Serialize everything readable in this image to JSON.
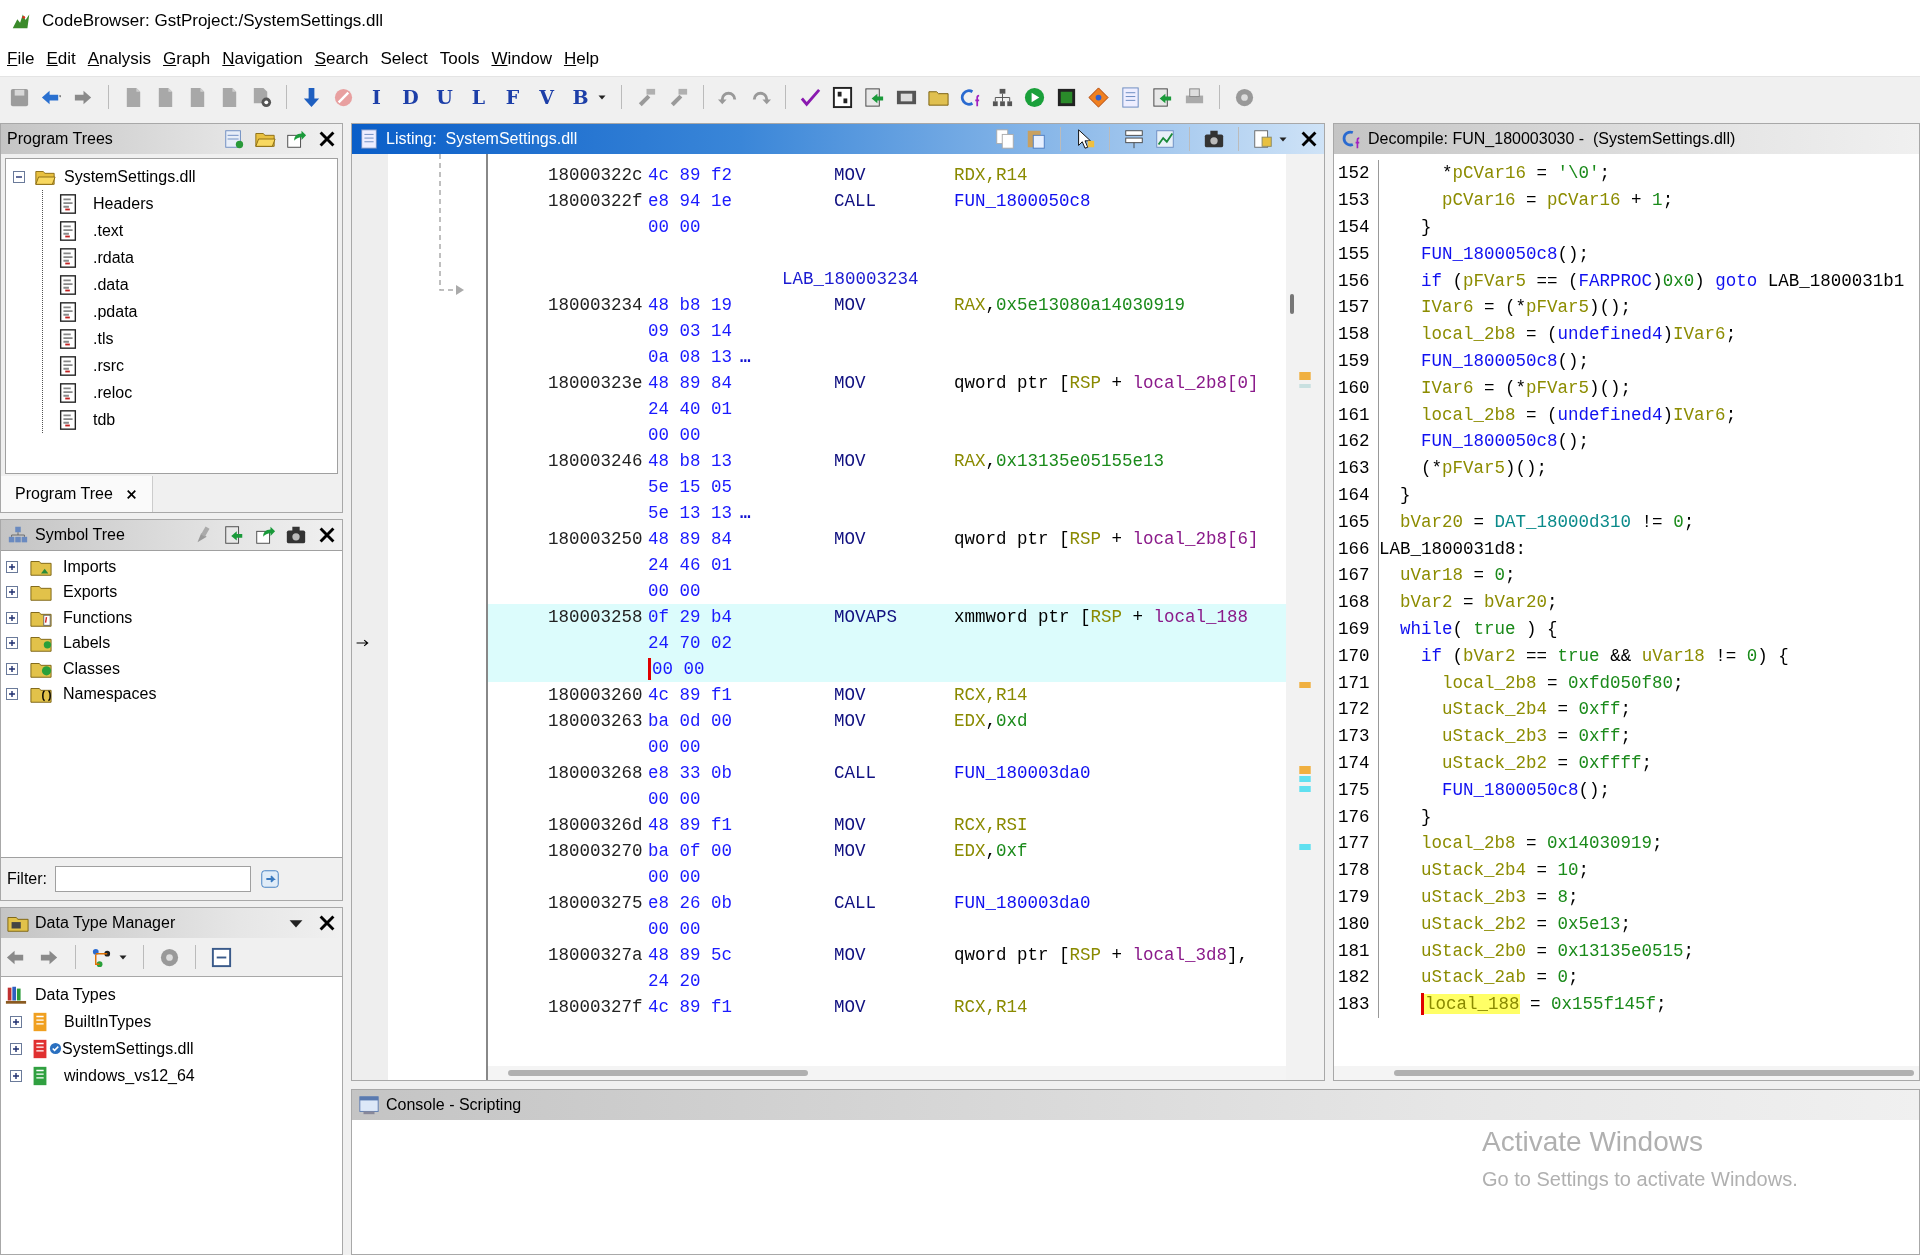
{
  "window": {
    "title": "CodeBrowser: GstProject:/SystemSettings.dll"
  },
  "menu": [
    {
      "label": "File",
      "underline_first": true
    },
    {
      "label": "Edit",
      "underline_first": true
    },
    {
      "label": "Analysis",
      "underline_first": true
    },
    {
      "label": "Graph",
      "underline_first": true
    },
    {
      "label": "Navigation",
      "underline_first": true
    },
    {
      "label": "Search",
      "underline_first": true
    },
    {
      "label": "Select",
      "underline_first": false
    },
    {
      "label": "Tools",
      "underline_first": false
    },
    {
      "label": "Window",
      "underline_first": true
    },
    {
      "label": "Help",
      "underline_first": true
    }
  ],
  "toolbar": {
    "letter_buttons": [
      "I",
      "D",
      "U",
      "L",
      "F",
      "V",
      "B"
    ]
  },
  "program_trees": {
    "title": "Program Trees",
    "root": {
      "label": "SystemSettings.dll",
      "expanded": true,
      "children": [
        {
          "label": "Headers"
        },
        {
          "label": ".text"
        },
        {
          "label": ".rdata"
        },
        {
          "label": ".data"
        },
        {
          "label": ".pdata"
        },
        {
          "label": ".tls"
        },
        {
          "label": ".rsrc"
        },
        {
          "label": ".reloc"
        },
        {
          "label": "tdb"
        }
      ]
    },
    "tab": {
      "label": "Program Tree"
    }
  },
  "symbol_tree": {
    "title": "Symbol Tree",
    "items": [
      {
        "label": "Imports",
        "expanded": false
      },
      {
        "label": "Exports",
        "expanded": false
      },
      {
        "label": "Functions",
        "expanded": false
      },
      {
        "label": "Labels",
        "expanded": false
      },
      {
        "label": "Classes",
        "expanded": false
      },
      {
        "label": "Namespaces",
        "expanded": false
      }
    ],
    "filter": {
      "label": "Filter:"
    }
  },
  "data_type_manager": {
    "title": "Data Type Manager",
    "root": {
      "label": "Data Types",
      "children": [
        {
          "label": "BuiltInTypes",
          "expanded": false,
          "color": "#f0a020",
          "badge": false
        },
        {
          "label": "SystemSettings.dll",
          "expanded": false,
          "color": "#e03030",
          "badge": true
        },
        {
          "label": "windows_vs12_64",
          "expanded": false,
          "color": "#30a040",
          "badge": false
        }
      ]
    }
  },
  "listing": {
    "title": "Listing:  SystemSettings.dll",
    "rows": [
      {
        "kind": "instr",
        "address": "18000322c",
        "bytes": [
          "4c 89 f2"
        ],
        "mnemonic": "MOV",
        "operands": [
          {
            "kind": "reg",
            "text": "RDX,R14"
          }
        ],
        "selected": false
      },
      {
        "kind": "instr",
        "address": "18000322f",
        "bytes": [
          "e8 94 1e",
          "00 00"
        ],
        "mnemonic": "CALL",
        "operands": [
          {
            "kind": "func",
            "text": "FUN_1800050c8"
          }
        ],
        "selected": false
      },
      {
        "kind": "label",
        "text": "LAB_180003234"
      },
      {
        "kind": "instr",
        "address": "180003234",
        "bytes": [
          "48 b8 19",
          "09 03 14",
          "0a 08 13"
        ],
        "more": "…",
        "mnemonic": "MOV",
        "operands": [
          {
            "kind": "reg",
            "text": "RAX"
          },
          {
            "kind": "plain",
            "text": ","
          },
          {
            "kind": "num",
            "text": "0x5e13080a14030919"
          }
        ],
        "selected": false
      },
      {
        "kind": "instr",
        "address": "18000323e",
        "bytes": [
          "48 89 84",
          "24 40 01",
          "00 00"
        ],
        "mnemonic": "MOV",
        "operands": [
          {
            "kind": "plain",
            "text": "qword ptr ["
          },
          {
            "kind": "reg",
            "text": "RSP"
          },
          {
            "kind": "plain",
            "text": " + "
          },
          {
            "kind": "var",
            "text": "local_2b8[0]"
          }
        ],
        "selected": false
      },
      {
        "kind": "instr",
        "address": "180003246",
        "bytes": [
          "48 b8 13",
          "5e 15 05",
          "5e 13 13"
        ],
        "more": "…",
        "mnemonic": "MOV",
        "operands": [
          {
            "kind": "reg",
            "text": "RAX"
          },
          {
            "kind": "plain",
            "text": ","
          },
          {
            "kind": "num",
            "text": "0x13135e05155e13"
          }
        ],
        "selected": false
      },
      {
        "kind": "instr",
        "address": "180003250",
        "bytes": [
          "48 89 84",
          "24 46 01",
          "00 00"
        ],
        "mnemonic": "MOV",
        "operands": [
          {
            "kind": "plain",
            "text": "qword ptr ["
          },
          {
            "kind": "reg",
            "text": "RSP"
          },
          {
            "kind": "plain",
            "text": " + "
          },
          {
            "kind": "var",
            "text": "local_2b8[6]"
          }
        ],
        "selected": false
      },
      {
        "kind": "instr",
        "address": "180003258",
        "bytes": [
          "0f 29 b4",
          "24 70 02",
          "00 00"
        ],
        "mnemonic": "MOVAPS",
        "operands": [
          {
            "kind": "plain",
            "text": "xmmword ptr ["
          },
          {
            "kind": "reg",
            "text": "RSP"
          },
          {
            "kind": "plain",
            "text": " + "
          },
          {
            "kind": "var",
            "text": "local_188"
          }
        ],
        "selected": true
      },
      {
        "kind": "instr",
        "address": "180003260",
        "bytes": [
          "4c 89 f1"
        ],
        "mnemonic": "MOV",
        "operands": [
          {
            "kind": "reg",
            "text": "RCX,R14"
          }
        ],
        "selected": false
      },
      {
        "kind": "instr",
        "address": "180003263",
        "bytes": [
          "ba 0d 00",
          "00 00"
        ],
        "mnemonic": "MOV",
        "operands": [
          {
            "kind": "reg",
            "text": "EDX"
          },
          {
            "kind": "plain",
            "text": ","
          },
          {
            "kind": "num",
            "text": "0xd"
          }
        ],
        "selected": false
      },
      {
        "kind": "instr",
        "address": "180003268",
        "bytes": [
          "e8 33 0b",
          "00 00"
        ],
        "mnemonic": "CALL",
        "operands": [
          {
            "kind": "func",
            "text": "FUN_180003da0"
          }
        ],
        "selected": false
      },
      {
        "kind": "instr",
        "address": "18000326d",
        "bytes": [
          "48 89 f1"
        ],
        "mnemonic": "MOV",
        "operands": [
          {
            "kind": "reg",
            "text": "RCX,RSI"
          }
        ],
        "selected": false
      },
      {
        "kind": "instr",
        "address": "180003270",
        "bytes": [
          "ba 0f 00",
          "00 00"
        ],
        "mnemonic": "MOV",
        "operands": [
          {
            "kind": "reg",
            "text": "EDX"
          },
          {
            "kind": "plain",
            "text": ","
          },
          {
            "kind": "num",
            "text": "0xf"
          }
        ],
        "selected": false
      },
      {
        "kind": "instr",
        "address": "180003275",
        "bytes": [
          "e8 26 0b",
          "00 00"
        ],
        "mnemonic": "CALL",
        "operands": [
          {
            "kind": "func",
            "text": "FUN_180003da0"
          }
        ],
        "selected": false
      },
      {
        "kind": "instr",
        "address": "18000327a",
        "bytes": [
          "48 89 5c",
          "24 20"
        ],
        "mnemonic": "MOV",
        "operands": [
          {
            "kind": "plain",
            "text": "qword ptr ["
          },
          {
            "kind": "reg",
            "text": "RSP"
          },
          {
            "kind": "plain",
            "text": " + "
          },
          {
            "kind": "var",
            "text": "local_3d8"
          },
          {
            "kind": "plain",
            "text": "],"
          }
        ],
        "selected": false
      },
      {
        "kind": "instr",
        "address": "18000327f",
        "bytes": [
          "4c 89 f1"
        ],
        "mnemonic": "MOV",
        "operands": [
          {
            "kind": "reg",
            "text": "RCX,R14"
          }
        ],
        "selected": false
      }
    ]
  },
  "decompile": {
    "title": "Decompile: FUN_180003030 -  (SystemSettings.dll)",
    "lines": [
      {
        "number": "152",
        "tokens": [
          {
            "kind": "plain",
            "text": "      *"
          },
          {
            "kind": "var",
            "text": "pCVar16"
          },
          {
            "kind": "plain",
            "text": " = "
          },
          {
            "kind": "num",
            "text": "'\\0'"
          },
          {
            "kind": "plain",
            "text": ";"
          }
        ]
      },
      {
        "number": "153",
        "tokens": [
          {
            "kind": "var",
            "text": "      pCVar16"
          },
          {
            "kind": "plain",
            "text": " = "
          },
          {
            "kind": "var",
            "text": "pCVar16"
          },
          {
            "kind": "plain",
            "text": " + "
          },
          {
            "kind": "num",
            "text": "1"
          },
          {
            "kind": "plain",
            "text": ";"
          }
        ]
      },
      {
        "number": "154",
        "tokens": [
          {
            "kind": "plain",
            "text": "    }"
          }
        ]
      },
      {
        "number": "155",
        "tokens": [
          {
            "kind": "func",
            "text": "    FUN_1800050c8"
          },
          {
            "kind": "plain",
            "text": "();"
          }
        ]
      },
      {
        "number": "156",
        "tokens": [
          {
            "kind": "keyword",
            "text": "    if"
          },
          {
            "kind": "plain",
            "text": " ("
          },
          {
            "kind": "var",
            "text": "pFVar5"
          },
          {
            "kind": "plain",
            "text": " == ("
          },
          {
            "kind": "type",
            "text": "FARPROC"
          },
          {
            "kind": "plain",
            "text": ")"
          },
          {
            "kind": "num",
            "text": "0x0"
          },
          {
            "kind": "plain",
            "text": ") "
          },
          {
            "kind": "keyword",
            "text": "goto"
          },
          {
            "kind": "plain",
            "text": " LAB_1800031b1"
          }
        ]
      },
      {
        "number": "157",
        "tokens": [
          {
            "kind": "var",
            "text": "    IVar6"
          },
          {
            "kind": "plain",
            "text": " = (*"
          },
          {
            "kind": "var",
            "text": "pFVar5"
          },
          {
            "kind": "plain",
            "text": ")();"
          }
        ]
      },
      {
        "number": "158",
        "tokens": [
          {
            "kind": "var",
            "text": "    local_2b8"
          },
          {
            "kind": "plain",
            "text": " = ("
          },
          {
            "kind": "type",
            "text": "undefined4"
          },
          {
            "kind": "plain",
            "text": ")"
          },
          {
            "kind": "var",
            "text": "IVar6"
          },
          {
            "kind": "plain",
            "text": ";"
          }
        ]
      },
      {
        "number": "159",
        "tokens": [
          {
            "kind": "func",
            "text": "    FUN_1800050c8"
          },
          {
            "kind": "plain",
            "text": "();"
          }
        ]
      },
      {
        "number": "160",
        "tokens": [
          {
            "kind": "var",
            "text": "    IVar6"
          },
          {
            "kind": "plain",
            "text": " = (*"
          },
          {
            "kind": "var",
            "text": "pFVar5"
          },
          {
            "kind": "plain",
            "text": ")();"
          }
        ]
      },
      {
        "number": "161",
        "tokens": [
          {
            "kind": "var",
            "text": "    local_2b8"
          },
          {
            "kind": "plain",
            "text": " = ("
          },
          {
            "kind": "type",
            "text": "undefined4"
          },
          {
            "kind": "plain",
            "text": ")"
          },
          {
            "kind": "var",
            "text": "IVar6"
          },
          {
            "kind": "plain",
            "text": ";"
          }
        ]
      },
      {
        "number": "162",
        "tokens": [
          {
            "kind": "func",
            "text": "    FUN_1800050c8"
          },
          {
            "kind": "plain",
            "text": "();"
          }
        ]
      },
      {
        "number": "163",
        "tokens": [
          {
            "kind": "plain",
            "text": "    (*"
          },
          {
            "kind": "var",
            "text": "pFVar5"
          },
          {
            "kind": "plain",
            "text": ")();"
          }
        ]
      },
      {
        "number": "164",
        "tokens": [
          {
            "kind": "plain",
            "text": "  }"
          }
        ]
      },
      {
        "number": "165",
        "tokens": [
          {
            "kind": "var",
            "text": "  bVar20"
          },
          {
            "kind": "plain",
            "text": " = "
          },
          {
            "kind": "global",
            "text": "DAT_18000d310"
          },
          {
            "kind": "plain",
            "text": " != "
          },
          {
            "kind": "num",
            "text": "0"
          },
          {
            "kind": "plain",
            "text": ";"
          }
        ]
      },
      {
        "number": "166",
        "tokens": [
          {
            "kind": "plain",
            "text": "LAB_1800031d8:"
          }
        ]
      },
      {
        "number": "167",
        "tokens": [
          {
            "kind": "var",
            "text": "  uVar18"
          },
          {
            "kind": "plain",
            "text": " = "
          },
          {
            "kind": "num",
            "text": "0"
          },
          {
            "kind": "plain",
            "text": ";"
          }
        ]
      },
      {
        "number": "168",
        "tokens": [
          {
            "kind": "var",
            "text": "  bVar2"
          },
          {
            "kind": "plain",
            "text": " = "
          },
          {
            "kind": "var",
            "text": "bVar20"
          },
          {
            "kind": "plain",
            "text": ";"
          }
        ]
      },
      {
        "number": "169",
        "tokens": [
          {
            "kind": "keyword",
            "text": "  while"
          },
          {
            "kind": "plain",
            "text": "( "
          },
          {
            "kind": "num",
            "text": "true"
          },
          {
            "kind": "plain",
            "text": " ) {"
          }
        ]
      },
      {
        "number": "170",
        "tokens": [
          {
            "kind": "keyword",
            "text": "    if"
          },
          {
            "kind": "plain",
            "text": " ("
          },
          {
            "kind": "var",
            "text": "bVar2"
          },
          {
            "kind": "plain",
            "text": " == "
          },
          {
            "kind": "num",
            "text": "true"
          },
          {
            "kind": "plain",
            "text": " && "
          },
          {
            "kind": "var",
            "text": "uVar18"
          },
          {
            "kind": "plain",
            "text": " != "
          },
          {
            "kind": "num",
            "text": "0"
          },
          {
            "kind": "plain",
            "text": ") {"
          }
        ]
      },
      {
        "number": "171",
        "tokens": [
          {
            "kind": "var",
            "text": "      local_2b8"
          },
          {
            "kind": "plain",
            "text": " = "
          },
          {
            "kind": "num",
            "text": "0xfd050f80"
          },
          {
            "kind": "plain",
            "text": ";"
          }
        ]
      },
      {
        "number": "172",
        "tokens": [
          {
            "kind": "var",
            "text": "      uStack_2b4"
          },
          {
            "kind": "plain",
            "text": " = "
          },
          {
            "kind": "num",
            "text": "0xff"
          },
          {
            "kind": "plain",
            "text": ";"
          }
        ]
      },
      {
        "number": "173",
        "tokens": [
          {
            "kind": "var",
            "text": "      uStack_2b3"
          },
          {
            "kind": "plain",
            "text": " = "
          },
          {
            "kind": "num",
            "text": "0xff"
          },
          {
            "kind": "plain",
            "text": ";"
          }
        ]
      },
      {
        "number": "174",
        "tokens": [
          {
            "kind": "var",
            "text": "      uStack_2b2"
          },
          {
            "kind": "plain",
            "text": " = "
          },
          {
            "kind": "num",
            "text": "0xffff"
          },
          {
            "kind": "plain",
            "text": ";"
          }
        ]
      },
      {
        "number": "175",
        "tokens": [
          {
            "kind": "func",
            "text": "      FUN_1800050c8"
          },
          {
            "kind": "plain",
            "text": "();"
          }
        ]
      },
      {
        "number": "176",
        "tokens": [
          {
            "kind": "plain",
            "text": "    }"
          }
        ]
      },
      {
        "number": "177",
        "tokens": [
          {
            "kind": "var",
            "text": "    local_2b8"
          },
          {
            "kind": "plain",
            "text": " = "
          },
          {
            "kind": "num",
            "text": "0x14030919"
          },
          {
            "kind": "plain",
            "text": ";"
          }
        ]
      },
      {
        "number": "178",
        "tokens": [
          {
            "kind": "var",
            "text": "    uStack_2b4"
          },
          {
            "kind": "plain",
            "text": " = "
          },
          {
            "kind": "num",
            "text": "10"
          },
          {
            "kind": "plain",
            "text": ";"
          }
        ]
      },
      {
        "number": "179",
        "tokens": [
          {
            "kind": "var",
            "text": "    uStack_2b3"
          },
          {
            "kind": "plain",
            "text": " = "
          },
          {
            "kind": "num",
            "text": "8"
          },
          {
            "kind": "plain",
            "text": ";"
          }
        ]
      },
      {
        "number": "180",
        "tokens": [
          {
            "kind": "var",
            "text": "    uStack_2b2"
          },
          {
            "kind": "plain",
            "text": " = "
          },
          {
            "kind": "num",
            "text": "0x5e13"
          },
          {
            "kind": "plain",
            "text": ";"
          }
        ]
      },
      {
        "number": "181",
        "tokens": [
          {
            "kind": "var",
            "text": "    uStack_2b0"
          },
          {
            "kind": "plain",
            "text": " = "
          },
          {
            "kind": "num",
            "text": "0x13135e0515"
          },
          {
            "kind": "plain",
            "text": ";"
          }
        ]
      },
      {
        "number": "182",
        "tokens": [
          {
            "kind": "var",
            "text": "    uStack_2ab"
          },
          {
            "kind": "plain",
            "text": " = "
          },
          {
            "kind": "num",
            "text": "0"
          },
          {
            "kind": "plain",
            "text": ";"
          }
        ]
      },
      {
        "number": "183",
        "tokens": [
          {
            "kind": "highlight",
            "text": "    local_188"
          },
          {
            "kind": "plain",
            "text": " = "
          },
          {
            "kind": "num",
            "text": "0x155f145f"
          },
          {
            "kind": "plain",
            "text": ";"
          }
        ]
      }
    ]
  },
  "console": {
    "title": "Console - Scripting"
  },
  "os_notice": {
    "title": "Activate Windows",
    "text": "Go to Settings to activate Windows."
  }
}
